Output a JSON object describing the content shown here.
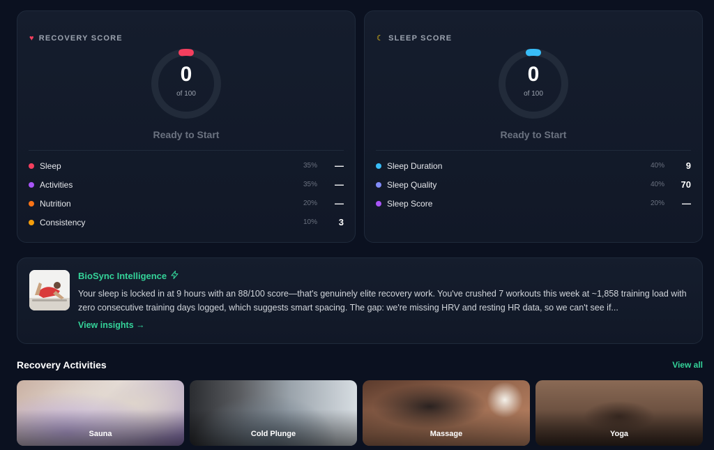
{
  "recovery": {
    "header": "RECOVERY SCORE",
    "icon": "heart-icon",
    "score": "0",
    "score_sub": "of 100",
    "status": "Ready to Start",
    "accent": "#f43f5e",
    "metrics": [
      {
        "label": "Sleep",
        "weight": "35%",
        "value": "—",
        "color": "#f43f5e"
      },
      {
        "label": "Activities",
        "weight": "35%",
        "value": "—",
        "color": "#a855f7"
      },
      {
        "label": "Nutrition",
        "weight": "20%",
        "value": "—",
        "color": "#f97316"
      },
      {
        "label": "Consistency",
        "weight": "10%",
        "value": "3",
        "color": "#f59e0b"
      }
    ]
  },
  "sleep": {
    "header": "SLEEP SCORE",
    "icon": "moon-icon",
    "score": "0",
    "score_sub": "of 100",
    "status": "Ready to Start",
    "accent": "#38bdf8",
    "metrics": [
      {
        "label": "Sleep Duration",
        "weight": "40%",
        "value": "9",
        "color": "#38bdf8"
      },
      {
        "label": "Sleep Quality",
        "weight": "40%",
        "value": "70",
        "color": "#818cf8"
      },
      {
        "label": "Sleep Score",
        "weight": "20%",
        "value": "—",
        "color": "#a855f7"
      }
    ]
  },
  "insight": {
    "title": "BioSync Intelligence",
    "text": "Your sleep is locked in at 9 hours with an 88/100 score—that's genuinely elite recovery work. You've crushed 7 workouts this week at ~1,858 training load with zero consecutive training days logged, which suggests smart spacing. The gap: we're missing HRV and resting HR data, so we can't see if...",
    "link": "View insights →"
  },
  "activities": {
    "title": "Recovery Activities",
    "view_all": "View all",
    "items": [
      {
        "label": "Sauna"
      },
      {
        "label": "Cold Plunge"
      },
      {
        "label": "Massage"
      },
      {
        "label": "Yoga"
      }
    ]
  }
}
